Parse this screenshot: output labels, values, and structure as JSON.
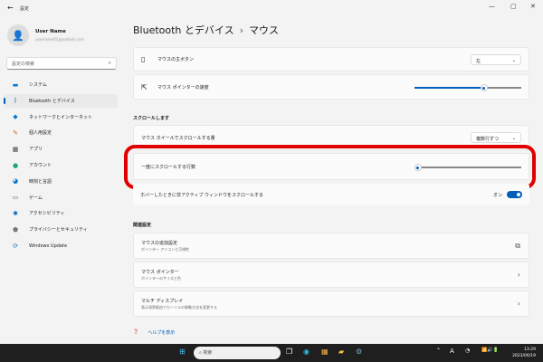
{
  "window": {
    "title": "設定",
    "back": "←",
    "min": "—",
    "max": "▢",
    "close": "✕"
  },
  "user": {
    "name": "User Name",
    "email": "username01@outlook.com"
  },
  "search": {
    "placeholder": "設定の検索"
  },
  "sidebar": {
    "items": [
      {
        "label": "システム",
        "icon": "monitor-icon",
        "glyph": "▬",
        "color": "#0078d4"
      },
      {
        "label": "Bluetooth とデバイス",
        "icon": "bluetooth-icon",
        "glyph": "ᛒ",
        "color": "#0067c0"
      },
      {
        "label": "ネットワークとインターネット",
        "icon": "wifi-icon",
        "glyph": "◆",
        "color": "#0078d4"
      },
      {
        "label": "個人用設定",
        "icon": "brush-icon",
        "glyph": "✎",
        "color": "#d06a2a"
      },
      {
        "label": "アプリ",
        "icon": "apps-icon",
        "glyph": "▦",
        "color": "#444"
      },
      {
        "label": "アカウント",
        "icon": "account-icon",
        "glyph": "●",
        "color": "#1aa37a"
      },
      {
        "label": "時刻と言語",
        "icon": "globe-icon",
        "glyph": "◕",
        "color": "#0078d4"
      },
      {
        "label": "ゲーム",
        "icon": "gamepad-icon",
        "glyph": "▭",
        "color": "#666"
      },
      {
        "label": "アクセシビリティ",
        "icon": "accessibility-icon",
        "glyph": "✱",
        "color": "#0067c0"
      },
      {
        "label": "プライバシーとセキュリティ",
        "icon": "shield-icon",
        "glyph": "⬟",
        "color": "#777"
      },
      {
        "label": "Windows Update",
        "icon": "update-icon",
        "glyph": "⟳",
        "color": "#0078d4"
      }
    ]
  },
  "header": {
    "parent": "Bluetooth とデバイス",
    "sep": "›",
    "current": "マウス"
  },
  "settings": {
    "primary_button": {
      "label": "マウスの主ボタン",
      "value": "左"
    },
    "pointer_speed": {
      "label": "マウス ポインターの速度",
      "value": 0.65
    },
    "scroll_section": "スクロールします",
    "wheel_amount": {
      "label": "マウス ホイールでスクロールする量",
      "value": "複数行ずつ"
    },
    "lines_per_scroll": {
      "label": "一度にスクロールする行数",
      "value": 0.03
    },
    "hover_scroll": {
      "label": "ホバーしたときに非アクティブ ウィンドウをスクロールする",
      "state": "オン"
    }
  },
  "related": {
    "title": "関連設定",
    "items": [
      {
        "title": "マウスの追加設定",
        "sub": "ポインター アイコンと可視性",
        "arrow": "⧉"
      },
      {
        "title": "マウス ポインター",
        "sub": "ポインターのサイズと色",
        "arrow": "›"
      },
      {
        "title": "マルチ ディスプレイ",
        "sub": "表示境界経由でカーソルの移動方法を変更する",
        "arrow": "›"
      }
    ]
  },
  "help": "ヘルプを表示",
  "taskbar": {
    "search": "検索",
    "time": "13:29",
    "date": "2023/06/19",
    "ime": "A"
  }
}
